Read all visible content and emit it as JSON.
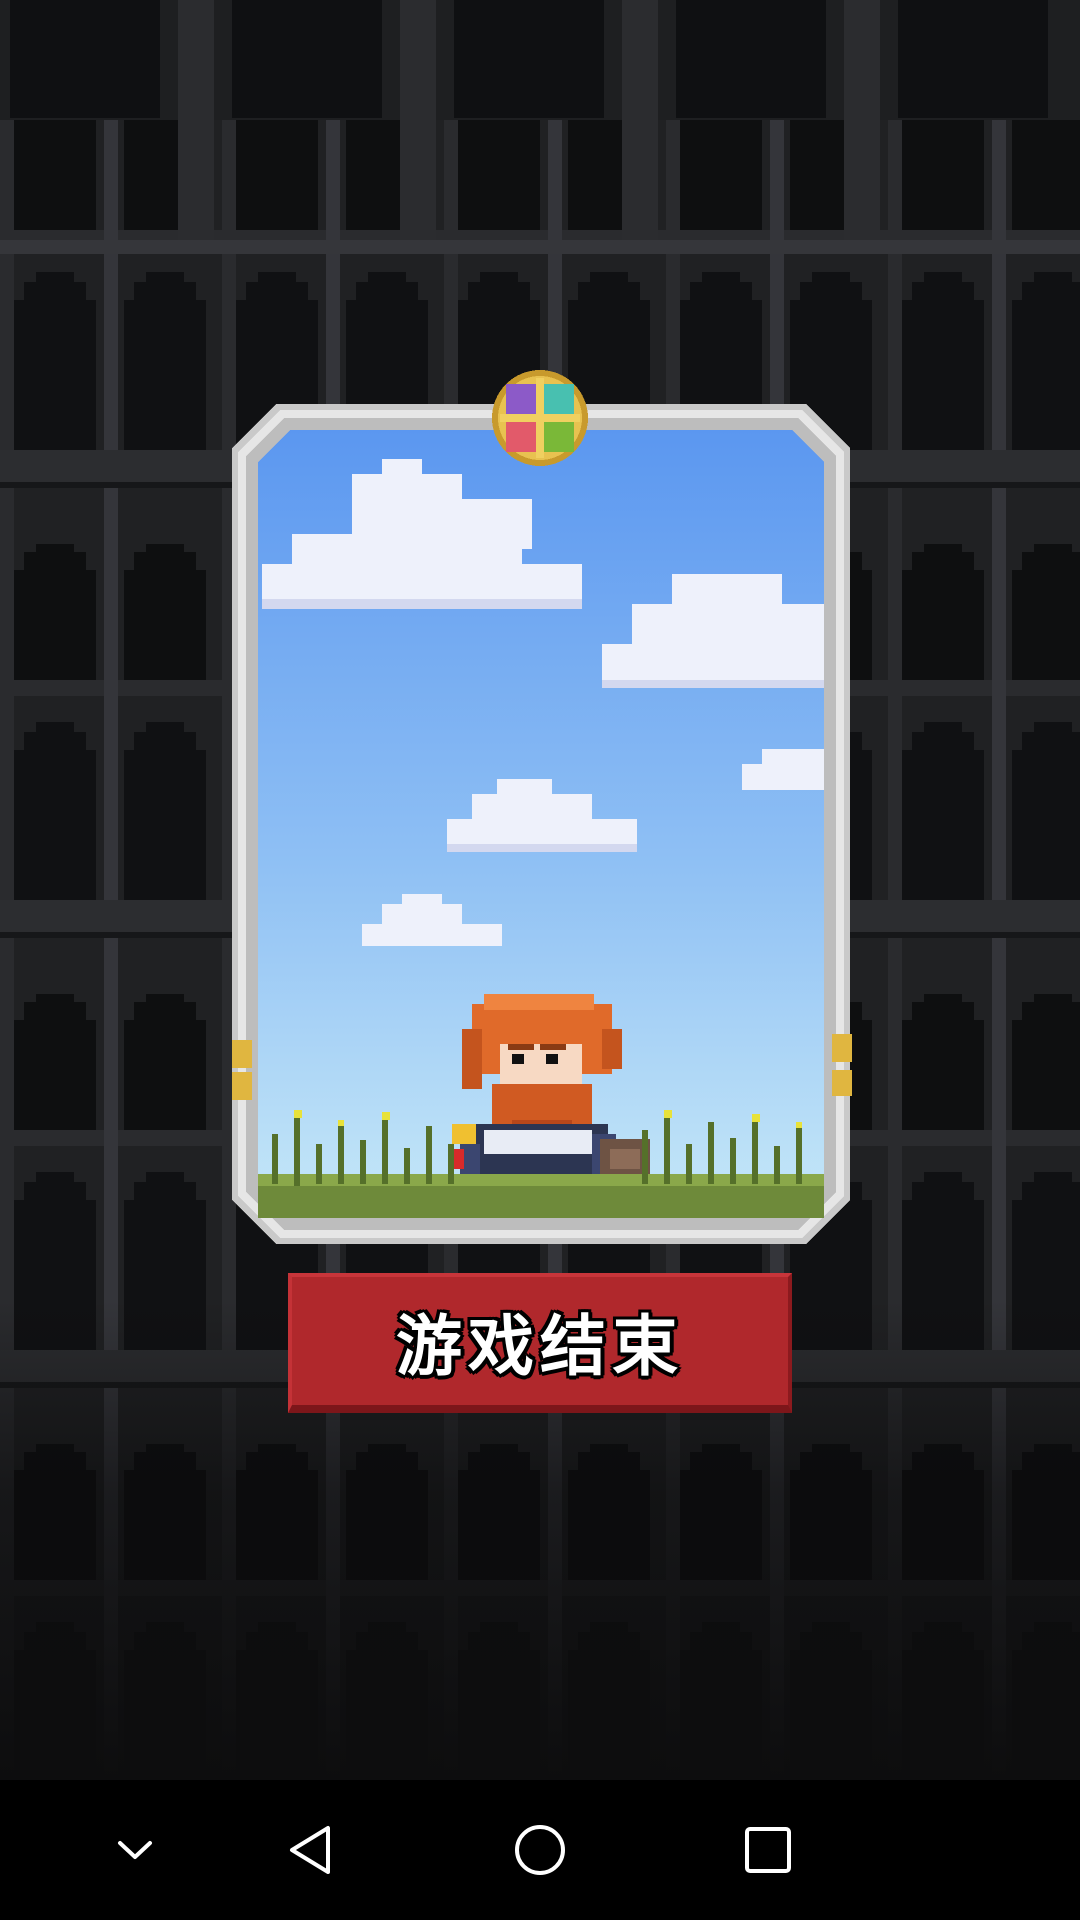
{
  "game": {
    "gameover_label": "游戏结束"
  },
  "card": {
    "scene": "hero-in-grass-under-sky",
    "gem_icon": "four-color-gem-icon"
  },
  "nav_bar": {
    "items": [
      {
        "icon": "chevron-down-icon"
      },
      {
        "icon": "back-triangle-icon"
      },
      {
        "icon": "home-circle-icon"
      },
      {
        "icon": "recents-square-icon"
      }
    ]
  },
  "colors": {
    "sky_top": "#5b97f0",
    "sky_bottom": "#c6e8f8",
    "frame_silver": "#c9c9c9",
    "button_red": "#b0282c",
    "hair_orange": "#e06a2a",
    "grass_green": "#6e8a3a"
  }
}
